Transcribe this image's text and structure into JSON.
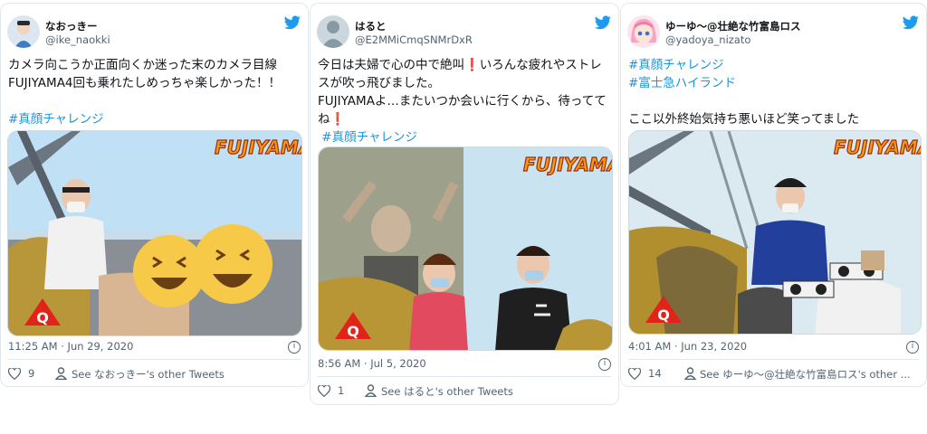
{
  "tweets": [
    {
      "display_name": "なおっきー",
      "handle": "@ike_naokki",
      "text": "カメラ向こうか正面向くか迷った末のカメラ目線FUJIYAMA4回も乗れたしめっちゃ楽しかった！！",
      "hashtags": [
        "#真顔チャレンジ"
      ],
      "media_logo": "FUJIYAMA",
      "timestamp": "11:25 AM · Jun 29, 2020",
      "likes": "9",
      "other_tweets": "See なおっきー's other Tweets"
    },
    {
      "display_name": "はると",
      "handle": "@E2MMiCmqSNMrDxR",
      "text": "今日は夫婦で心の中で絶叫❗️いろんな疲れやストレスが吹っ飛びました。\nFUJIYAMAよ…またいつか会いに行くから、待っててね❗️",
      "hashtags": [
        " #真顔チャレンジ"
      ],
      "media_logo": "FUJIYAMA",
      "timestamp": "8:56 AM · Jul 5, 2020",
      "likes": "1",
      "other_tweets": "See はると's other Tweets"
    },
    {
      "display_name": "ゆーゆ〜@壮絶な竹富島ロス",
      "handle": "@yadoya_nizato",
      "text": "ここ以外終始気持ち悪いほど笑ってました",
      "hashtags": [
        "#真顔チャレンジ",
        "#富士急ハイランド"
      ],
      "media_logo": "FUJIYAMA",
      "timestamp": "4:01 AM · Jun 23, 2020",
      "likes": "14",
      "other_tweets": "See ゆーゆ〜@壮絶な竹富島ロス's other ..."
    }
  ],
  "colors": {
    "twitter_blue": "#1d9bf0",
    "hashtag": "#1b95e0",
    "muted": "#536471"
  },
  "icons": [
    "twitter-bird-icon",
    "info-icon",
    "heart-icon",
    "person-icon"
  ]
}
